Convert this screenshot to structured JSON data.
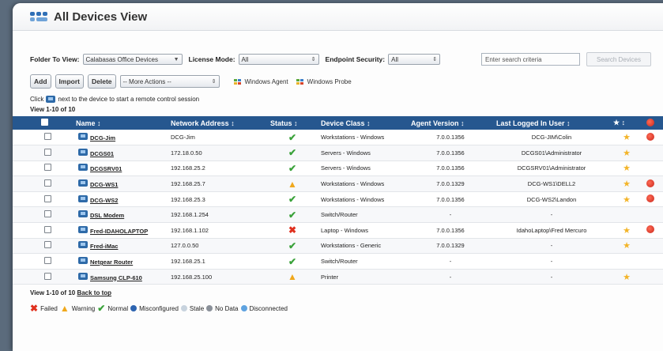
{
  "window": {
    "title": "All Devices View"
  },
  "filters": {
    "folder_label": "Folder To View:",
    "folder_value": "Calabasas Office Devices",
    "license_label": "License Mode:",
    "license_value": "All",
    "endpoint_label": "Endpoint Security:",
    "endpoint_value": "All",
    "search_placeholder": "Enter search criteria",
    "search_button": "Search Devices"
  },
  "actions": {
    "add": "Add",
    "import": "Import",
    "delete": "Delete",
    "more_actions": "-- More Actions --",
    "windows_agent": "Windows Agent",
    "windows_probe": "Windows Probe"
  },
  "hint": {
    "before": "Click",
    "after": "next to the device to start a remote control session"
  },
  "view_count": "View 1-10 of 10",
  "columns": {
    "name": "Name ↕",
    "address": "Network Address ↕",
    "status": "Status ↕",
    "device_class": "Device Class ↕",
    "agent_version": "Agent Version ↕",
    "last_user": "Last Logged In User ↕",
    "fav": "★ ↕"
  },
  "rows": [
    {
      "name": "DCG-Jim",
      "address": "DCG-Jim",
      "status": "ok",
      "device_class": "Workstations - Windows",
      "agent_version": "7.0.0.1356",
      "last_user": "DCG-JIM\\Colin",
      "fav": true,
      "alert": true
    },
    {
      "name": "DCGS01",
      "address": "172.18.0.50",
      "status": "ok",
      "device_class": "Servers - Windows",
      "agent_version": "7.0.0.1356",
      "last_user": "DCGS01\\Administrator",
      "fav": true,
      "alert": false
    },
    {
      "name": "DCGSRV01",
      "address": "192.168.25.2",
      "status": "ok",
      "device_class": "Servers - Windows",
      "agent_version": "7.0.0.1356",
      "last_user": "DCGSRV01\\Administrator",
      "fav": true,
      "alert": false
    },
    {
      "name": "DCG-WS1",
      "address": "192.168.25.7",
      "status": "warn",
      "device_class": "Workstations - Windows",
      "agent_version": "7.0.0.1329",
      "last_user": "DCG-WS1\\DELL2",
      "fav": true,
      "alert": true
    },
    {
      "name": "DCG-WS2",
      "address": "192.168.25.3",
      "status": "ok",
      "device_class": "Workstations - Windows",
      "agent_version": "7.0.0.1356",
      "last_user": "DCG-WS2\\Landon",
      "fav": true,
      "alert": true
    },
    {
      "name": "DSL Modem",
      "address": "192.168.1.254",
      "status": "ok",
      "device_class": "Switch/Router",
      "agent_version": "-",
      "last_user": "-",
      "fav": false,
      "alert": false
    },
    {
      "name": "Fred-IDAHOLAPTOP",
      "address": "192.168.1.102",
      "status": "fail",
      "device_class": "Laptop - Windows",
      "agent_version": "7.0.0.1356",
      "last_user": "IdahoLaptop\\Fred Mercuro",
      "fav": true,
      "alert": true
    },
    {
      "name": "Fred-iMac",
      "address": "127.0.0.50",
      "status": "ok",
      "device_class": "Workstations - Generic",
      "agent_version": "7.0.0.1329",
      "last_user": "-",
      "fav": true,
      "alert": false
    },
    {
      "name": "Netgear Router",
      "address": "192.168.25.1",
      "status": "ok",
      "device_class": "Switch/Router",
      "agent_version": "-",
      "last_user": "-",
      "fav": false,
      "alert": false
    },
    {
      "name": "Samsung CLP-610",
      "address": "192.168.25.100",
      "status": "warn",
      "device_class": "Printer",
      "agent_version": "-",
      "last_user": "-",
      "fav": true,
      "alert": false
    }
  ],
  "footer": {
    "view_count": "View 1-10 of 10",
    "back_to_top": "Back to top"
  },
  "legend": {
    "failed": "Failed",
    "warning": "Warning",
    "normal": "Normal",
    "misconfigured": "Misconfigured",
    "stale": "Stale",
    "no_data": "No Data",
    "disconnected": "Disconnected"
  },
  "colors": {
    "header_bg": "#26578f",
    "ok": "#3aa23a",
    "warn": "#f0a81c",
    "fail": "#e0301e",
    "star": "#f3b428"
  }
}
